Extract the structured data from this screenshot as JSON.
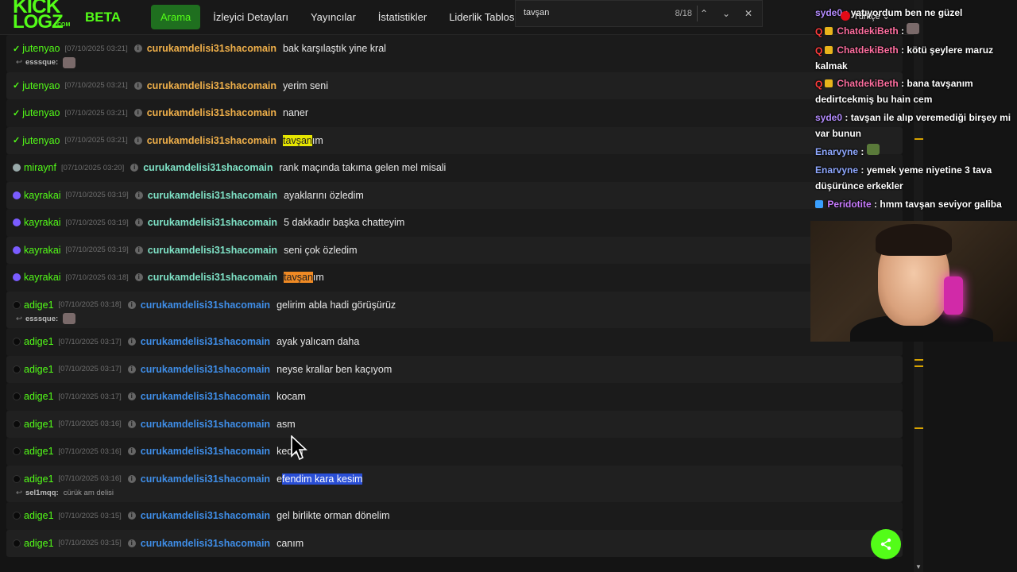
{
  "header": {
    "logo_top": "KICK",
    "logo_bottom": "LOGZ",
    "logo_domain": ".COM",
    "beta": "BETA",
    "nav": [
      {
        "label": "Arama",
        "active": true
      },
      {
        "label": "İzleyici Detayları",
        "active": false
      },
      {
        "label": "Yayıncılar",
        "active": false
      },
      {
        "label": "İstatistikler",
        "active": false
      },
      {
        "label": "Liderlik Tablosu",
        "active": false
      }
    ]
  },
  "find": {
    "query": "tavşan",
    "count": "8/18"
  },
  "rows": [
    {
      "user": "jutenyao",
      "ts": "[07/10/2025 03:21]",
      "channel": "curukamdelisi31shacomain",
      "pre": "bak karşılaştık yine kral",
      "hl": "",
      "post": "",
      "reply_user": "esssque:",
      "reply_text": ""
    },
    {
      "user": "jutenyao",
      "ts": "[07/10/2025 03:21]",
      "channel": "curukamdelisi31shacomain",
      "pre": "yerim seni",
      "hl": "",
      "post": ""
    },
    {
      "user": "jutenyao",
      "ts": "[07/10/2025 03:21]",
      "channel": "curukamdelisi31shacomain",
      "pre": "naner",
      "hl": "",
      "post": ""
    },
    {
      "user": "jutenyao",
      "ts": "[07/10/2025 03:21]",
      "channel": "curukamdelisi31shacomain",
      "pre": "",
      "hl": "tavşan",
      "post": "ım"
    },
    {
      "user": "miraynf",
      "ts": "[07/10/2025 03:20]",
      "channel": "curukamdelisi31shacomain",
      "pre": "rank maçında takıma gelen mel misali",
      "hl": "",
      "post": ""
    },
    {
      "user": "kayrakai",
      "ts": "[07/10/2025 03:19]",
      "channel": "curukamdelisi31shacomain",
      "pre": "ayaklarını özledim",
      "hl": "",
      "post": ""
    },
    {
      "user": "kayrakai",
      "ts": "[07/10/2025 03:19]",
      "channel": "curukamdelisi31shacomain",
      "pre": "5 dakkadır başka chatteyim",
      "hl": "",
      "post": ""
    },
    {
      "user": "kayrakai",
      "ts": "[07/10/2025 03:19]",
      "channel": "curukamdelisi31shacomain",
      "pre": "seni çok özledim",
      "hl": "",
      "post": ""
    },
    {
      "user": "kayrakai",
      "ts": "[07/10/2025 03:18]",
      "channel": "curukamdelisi31shacomain",
      "pre": "",
      "hl": "tavşan",
      "post": "ım"
    },
    {
      "user": "adige1",
      "ts": "[07/10/2025 03:18]",
      "channel": "curukamdelisi31shacomain",
      "pre": "gelirim abla hadi görüşürüz",
      "hl": "",
      "post": "",
      "reply_user": "esssque:",
      "reply_text": ""
    },
    {
      "user": "adige1",
      "ts": "[07/10/2025 03:17]",
      "channel": "curukamdelisi31shacomain",
      "pre": "ayak yalıcam daha",
      "hl": "",
      "post": ""
    },
    {
      "user": "adige1",
      "ts": "[07/10/2025 03:17]",
      "channel": "curukamdelisi31shacomain",
      "pre": "neyse krallar ben kaçıyom",
      "hl": "",
      "post": ""
    },
    {
      "user": "adige1",
      "ts": "[07/10/2025 03:17]",
      "channel": "curukamdelisi31shacomain",
      "pre": "kocam",
      "hl": "",
      "post": ""
    },
    {
      "user": "adige1",
      "ts": "[07/10/2025 03:16]",
      "channel": "curukamdelisi31shacomain",
      "pre": "as",
      "hl": "",
      "post": "m"
    },
    {
      "user": "adige1",
      "ts": "[07/10/2025 03:16]",
      "channel": "curukamdelisi31shacomain",
      "pre": "kedim",
      "hl": "",
      "post": ""
    },
    {
      "user": "adige1",
      "ts": "[07/10/2025 03:16]",
      "channel": "curukamdelisi31shacomain",
      "pre": "e",
      "hl": "fendim kara kesim",
      "post": "",
      "reply_user": "sel1mqq:",
      "reply_text": "cürük am delisi"
    },
    {
      "user": "adige1",
      "ts": "[07/10/2025 03:15]",
      "channel": "curukamdelisi31shacomain",
      "pre": "gel birlikte orman dönelim",
      "hl": "",
      "post": ""
    },
    {
      "user": "adige1",
      "ts": "[07/10/2025 03:15]",
      "channel": "curukamdelisi31shacomain",
      "pre": "canım",
      "hl": "",
      "post": ""
    }
  ],
  "overlay": {
    "language": "Türkçe",
    "messages": [
      {
        "name": "syde0",
        "text": "yatıyordum ben ne güzel"
      },
      {
        "name": "ChatdekiBeth",
        "text": ""
      },
      {
        "name": "ChatdekiBeth",
        "text": "kötü şeylere maruz kalmak"
      },
      {
        "name": "ChatdekiBeth",
        "text": "bana tavşanım dedirtcekmiş bu hain cem"
      },
      {
        "name": "syde0",
        "text": "tavşan ile alıp veremediği birşey mi var bunun"
      },
      {
        "name": "Enarvyne",
        "text": ""
      },
      {
        "name": "Enarvyne",
        "text": "yemek yeme niyetine 3 tava düşürünce erkekler"
      },
      {
        "name": "Peridotite",
        "text": "hmm tavşan seviyor galiba"
      }
    ]
  },
  "colors": {
    "accent": "#53fc18",
    "channel_orange": "#f0b04a",
    "channel_teal": "#7fe3c7",
    "channel_blue": "#3f8ee8"
  }
}
